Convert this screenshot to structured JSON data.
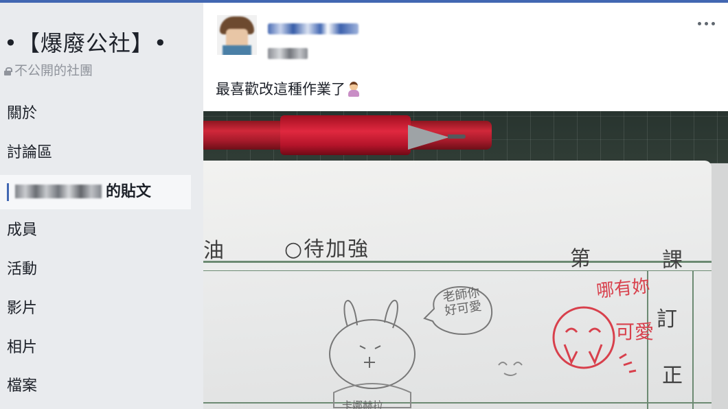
{
  "sidebar": {
    "group_title": "•【爆廢公社】•",
    "privacy_label": "不公開的社團",
    "nav": {
      "about": "關於",
      "discussion": "討論區",
      "my_posts_suffix": "的貼文",
      "members": "成員",
      "events": "活動",
      "videos": "影片",
      "photos": "相片",
      "files": "檔案"
    }
  },
  "post": {
    "text": "最喜歡改這種作業了",
    "photo": {
      "worksheet": {
        "you": "油",
        "needs_improvement": "○待加強",
        "lesson_di": "第",
        "lesson_ke": "課",
        "ding": "訂",
        "zheng": "正"
      },
      "student_drawing": {
        "bubble_text": "老師你好可愛",
        "caption": "卡娜赫拉"
      },
      "teacher_reply": {
        "text_top": "哪有妳",
        "text_side": "可愛"
      }
    }
  },
  "icons": {
    "lock": "lock-icon",
    "more": "more-options-icon",
    "emoji": "woman-emoji-icon"
  },
  "colors": {
    "brand": "#4267b2",
    "sidebar_bg": "#e9ebee",
    "pen_red": "#d0283a",
    "teacher_ink": "#d8404c"
  }
}
